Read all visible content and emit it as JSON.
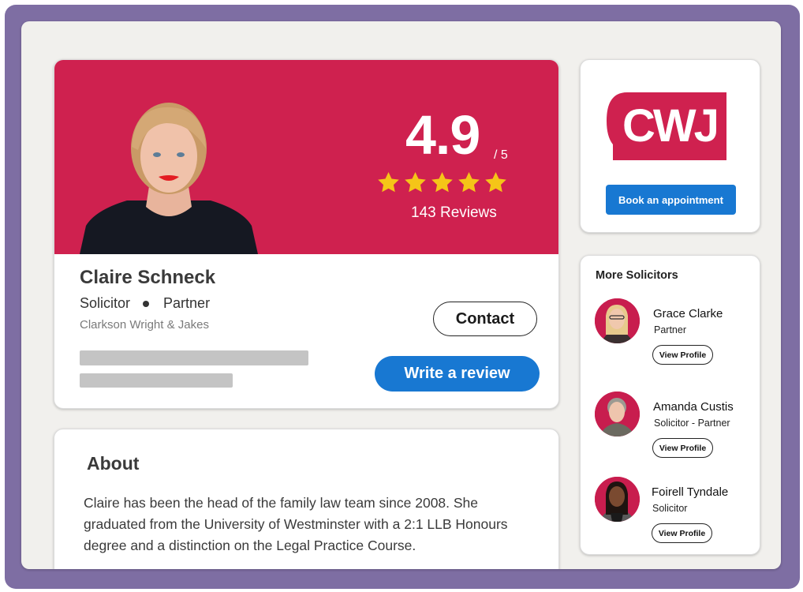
{
  "profile": {
    "name": "Claire Schneck",
    "role": "Solicitor",
    "title": "Partner",
    "firm": "Clarkson Wright & Jakes",
    "rating": "4.9",
    "rating_max": "/ 5",
    "stars_filled": 5,
    "stars_total": 5,
    "reviews": "143 Reviews",
    "contact_label": "Contact",
    "write_review_label": "Write a review",
    "hero_color": "#cf214f"
  },
  "about": {
    "title": "About",
    "text": "Claire has been the head of the family law team since 2008. She graduated from the University of Westminster with a 2:1 LLB Honours degree and a distinction on the Legal Practice Course."
  },
  "firm_card": {
    "logo_text": "CWJ",
    "book_label": "Book an appointment",
    "brand_color": "#cf214f",
    "button_color": "#1878d2"
  },
  "more_solicitors": {
    "title": "More Solicitors",
    "items": [
      {
        "name": "Grace Clarke",
        "role": "Partner",
        "button": "View Profile"
      },
      {
        "name": "Amanda Custis",
        "role": "Solicitor - Partner",
        "button": "View Profile"
      },
      {
        "name": "Foirell Tyndale",
        "role": "Solicitor",
        "button": "View Profile"
      }
    ]
  }
}
